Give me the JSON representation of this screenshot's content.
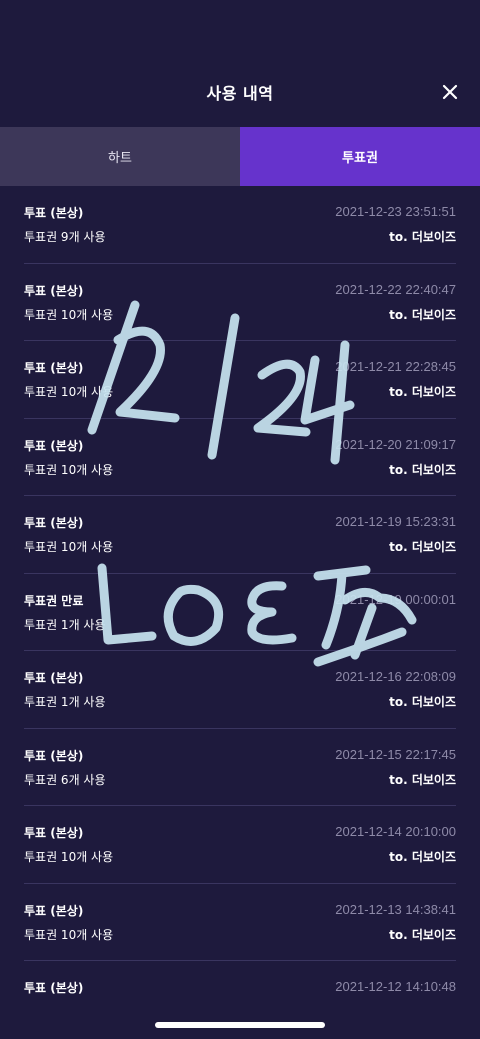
{
  "header": {
    "title": "사용 내역",
    "close_icon": "close-icon"
  },
  "tabs": [
    {
      "label": "하트",
      "active": false
    },
    {
      "label": "투표권",
      "active": true
    }
  ],
  "colors": {
    "accent": "#6633cc",
    "background": "#1e1a3d",
    "inactive_tab": "#3d3759",
    "date_text": "#8e8aa8"
  },
  "items": [
    {
      "type": "투표 (본상)",
      "date": "2021-12-23 23:51:51",
      "desc": "투표권 9개 사용",
      "to": "to. 더보이즈"
    },
    {
      "type": "투표 (본상)",
      "date": "2021-12-22 22:40:47",
      "desc": "투표권 10개 사용",
      "to": "to. 더보이즈"
    },
    {
      "type": "투표 (본상)",
      "date": "2021-12-21 22:28:45",
      "desc": "투표권 10개 사용",
      "to": "to. 더보이즈"
    },
    {
      "type": "투표 (본상)",
      "date": "2021-12-20 21:09:17",
      "desc": "투표권 10개 사용",
      "to": "to. 더보이즈"
    },
    {
      "type": "투표 (본상)",
      "date": "2021-12-19 15:23:31",
      "desc": "투표권 10개 사용",
      "to": "to. 더보이즈"
    },
    {
      "type": "투표권 만료",
      "date": "2021-12-19 00:00:01",
      "desc": "투표권 1개 사용",
      "to": ""
    },
    {
      "type": "투표 (본상)",
      "date": "2021-12-16 22:08:09",
      "desc": "투표권 1개 사용",
      "to": "to. 더보이즈"
    },
    {
      "type": "투표 (본상)",
      "date": "2021-12-15 22:17:45",
      "desc": "투표권 6개 사용",
      "to": "to. 더보이즈"
    },
    {
      "type": "투표 (본상)",
      "date": "2021-12-14 20:10:00",
      "desc": "투표권 10개 사용",
      "to": "to. 더보이즈"
    },
    {
      "type": "투표 (본상)",
      "date": "2021-12-13 14:38:41",
      "desc": "투표권 10개 사용",
      "to": "to. 더보이즈"
    },
    {
      "type": "투표 (본상)",
      "date": "2021-12-12 14:10:48",
      "desc": "",
      "to": ""
    }
  ]
}
